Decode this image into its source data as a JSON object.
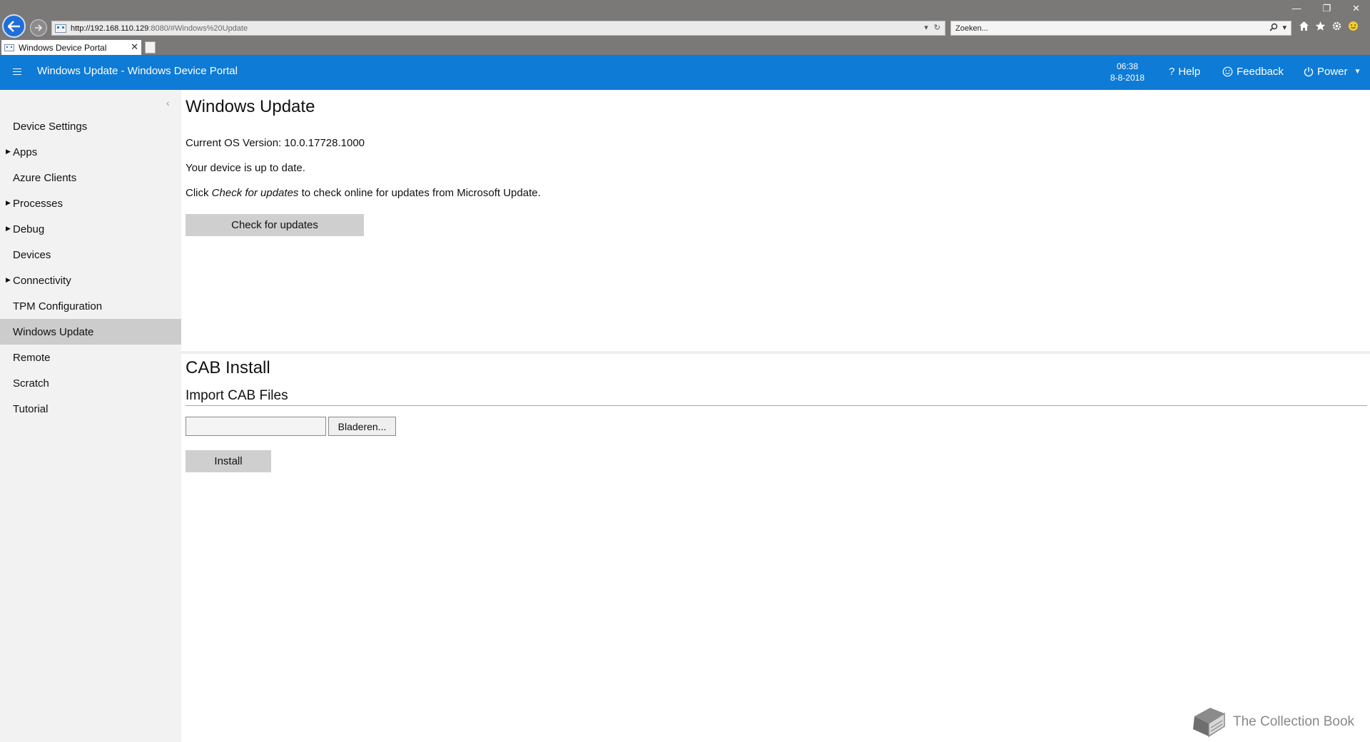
{
  "browser": {
    "url_host": "http://192.168.110.129",
    "url_rest": ":8080/#Windows%20Update",
    "search_placeholder": "Zoeken...",
    "tab_title": "Windows Device Portal"
  },
  "header": {
    "title": "Windows Update - Windows Device Portal",
    "time": "06:38",
    "date": "8-8-2018",
    "help_label": "Help",
    "feedback_label": "Feedback",
    "power_label": "Power"
  },
  "sidebar": {
    "items": [
      {
        "label": "Device Settings",
        "expandable": false
      },
      {
        "label": "Apps",
        "expandable": true
      },
      {
        "label": "Azure Clients",
        "expandable": false
      },
      {
        "label": "Processes",
        "expandable": true
      },
      {
        "label": "Debug",
        "expandable": true
      },
      {
        "label": "Devices",
        "expandable": false
      },
      {
        "label": "Connectivity",
        "expandable": true
      },
      {
        "label": "TPM Configuration",
        "expandable": false
      },
      {
        "label": "Windows Update",
        "expandable": false,
        "active": true
      },
      {
        "label": "Remote",
        "expandable": false
      },
      {
        "label": "Scratch",
        "expandable": false
      },
      {
        "label": "Tutorial",
        "expandable": false
      }
    ]
  },
  "update": {
    "heading": "Windows Update",
    "os_version": "Current OS Version: 10.0.17728.1000",
    "status": "Your device is up to date.",
    "hint_prefix": "Click ",
    "hint_emph": "Check for updates",
    "hint_suffix": " to check online for updates from Microsoft Update.",
    "check_button": "Check for updates"
  },
  "cab": {
    "heading": "CAB Install",
    "subheading": "Import CAB Files",
    "file_value": "",
    "browse_button": "Bladeren...",
    "install_button": "Install"
  },
  "watermark": {
    "text": "The Collection Book"
  },
  "colors": {
    "appbar": "#0e7bd6",
    "sidebar": "#f2f2f2",
    "sidebar_active": "#cccccc",
    "button": "#cfcfcf"
  }
}
